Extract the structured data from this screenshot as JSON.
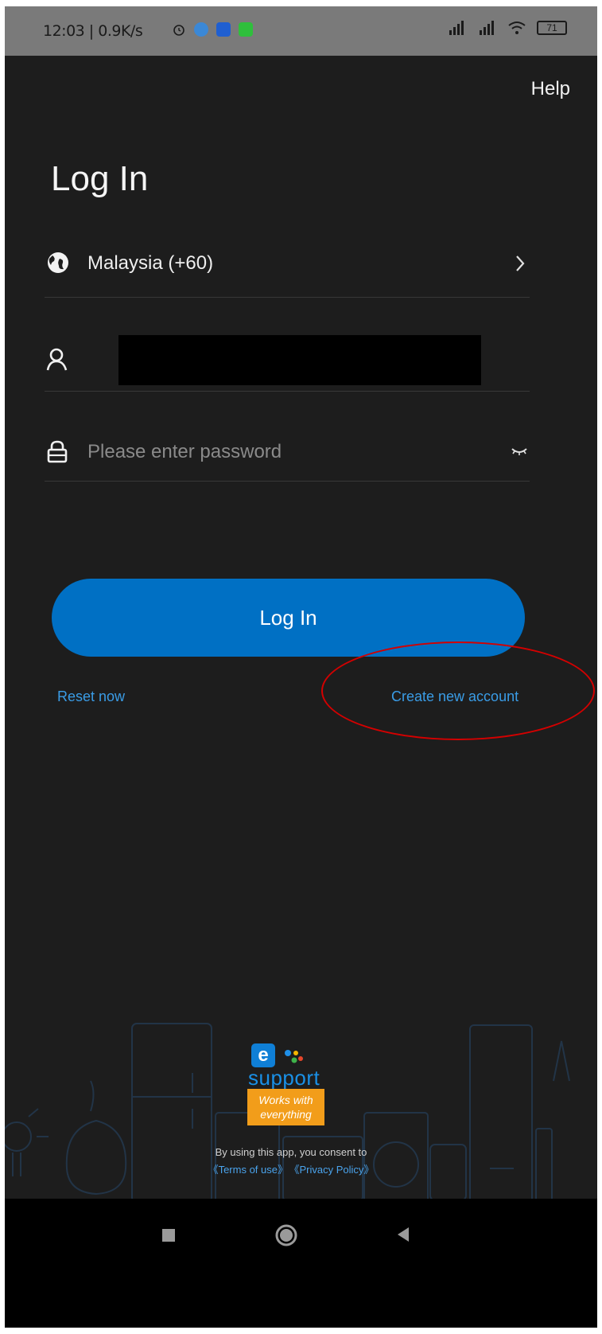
{
  "status_bar": {
    "time_speed": "12:03 | 0.9K/s",
    "battery": "71"
  },
  "header": {
    "help_label": "Help",
    "title": "Log In"
  },
  "form": {
    "country": "Malaysia (+60)",
    "password_placeholder": "Please enter password"
  },
  "actions": {
    "login_label": "Log In",
    "reset_label": "Reset now",
    "create_label": "Create new account"
  },
  "footer": {
    "logo_letter": "e",
    "logo_word": "support",
    "works_with": "Works with everything",
    "consent": "By using this app, you consent to",
    "terms": "《Terms of use》",
    "privacy": "《Privacy Policy》"
  },
  "colors": {
    "background": "#1d1d1d",
    "accent": "#0070c4",
    "link": "#3a9ce6",
    "annotation": "#d40000"
  },
  "icons": [
    "globe-icon",
    "chevron-right-icon",
    "user-icon",
    "lock-icon",
    "eye-closed-icon",
    "stop-icon",
    "home-icon",
    "back-icon"
  ]
}
